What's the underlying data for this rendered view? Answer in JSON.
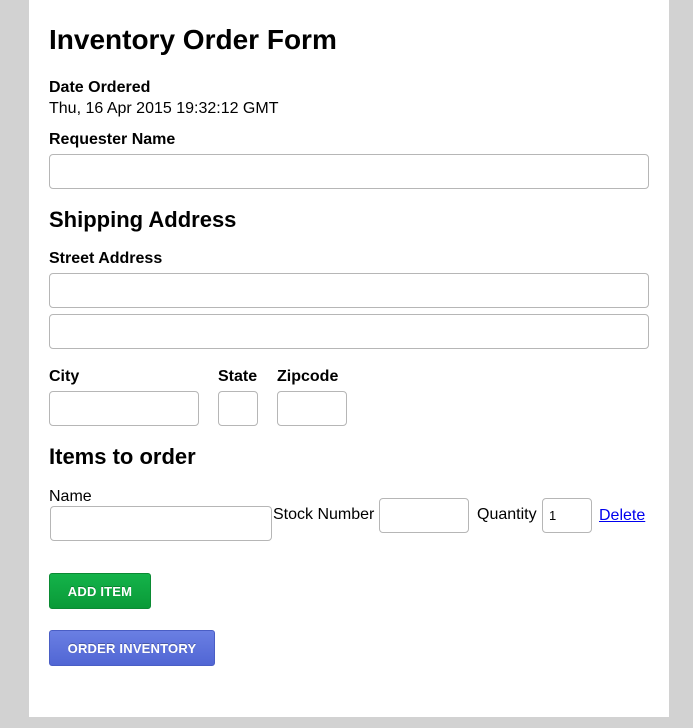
{
  "form": {
    "title": "Inventory Order Form",
    "date_label": "Date Ordered",
    "date_value": "Thu, 16 Apr 2015 19:32:12 GMT",
    "requester_label": "Requester Name",
    "requester_value": ""
  },
  "shipping": {
    "heading": "Shipping Address",
    "street_label": "Street Address",
    "street_line1": "",
    "street_line2": "",
    "city_label": "City",
    "state_label": "State",
    "zip_label": "Zipcode"
  },
  "items": {
    "heading": "Items to order",
    "name_label": "Name",
    "stock_label": "Stock Number",
    "quantity_label": "Quantity",
    "quantity_value": "1",
    "delete_label": "Delete"
  },
  "buttons": {
    "add_item": "ADD ITEM",
    "order_inventory": "ORDER INVENTORY"
  },
  "colors": {
    "background": "#d2d2d2",
    "add_button": "#0fa840",
    "order_button": "#5c72db",
    "link": "#0000ee"
  }
}
